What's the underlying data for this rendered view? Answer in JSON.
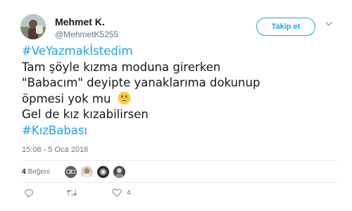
{
  "author": {
    "name": "Mehmet K.",
    "handle": "@MehmetK5255"
  },
  "follow_button": {
    "label": "Takip et"
  },
  "tweet": {
    "hashtag1": "#VeYazmakİstedim",
    "line1": "Tam şöyle kızma moduna girerken",
    "line2": "\"Babacım\" deyipte yanaklarıma dokunup",
    "line3": "öpmesi yok mu",
    "line4": "Gel de kız kızabilirsen",
    "hashtag2": "#KızBabası"
  },
  "timestamp": "15:08 - 5 Oca 2018",
  "likes": {
    "count": "4",
    "label": "Beğeni"
  },
  "actions": {
    "like_count": "4"
  },
  "colors": {
    "accent": "#1da1f2",
    "secondary_text": "#657786",
    "divider": "#e6ecf0"
  }
}
